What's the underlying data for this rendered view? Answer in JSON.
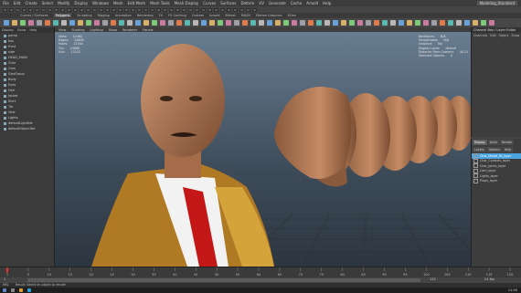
{
  "menubar": {
    "items": [
      "File",
      "Edit",
      "Create",
      "Select",
      "Modify",
      "Display",
      "Windows",
      "Mesh",
      "Edit Mesh",
      "Mesh Tools",
      "Mesh Display",
      "Curves",
      "Surfaces",
      "Deform",
      "UV",
      "Generate",
      "Cache",
      "Arnold",
      "Help"
    ],
    "workspace": "Modeling_Standard"
  },
  "shelf": {
    "tabs": [
      "Curves / Surfaces",
      "Polygons",
      "Sculpting",
      "Rigging",
      "Animation",
      "Rendering",
      "FX",
      "FX Caching",
      "Custom",
      "Arnold",
      "Bifrost",
      "MASH",
      "Motion Graphics",
      "XGen"
    ],
    "active_tab": "Polygons"
  },
  "outliner": {
    "header": [
      "Display",
      "Show",
      "Help"
    ],
    "items": [
      "persp",
      "top",
      "front",
      "side",
      "HEAD_MAIN",
      "Char",
      "Cam",
      "GeoGroup",
      "Body",
      "Eyes",
      "Hair",
      "Jacket",
      "Shirt",
      "Tie",
      "Vest",
      "Lights",
      "defaultLightSet",
      "defaultObjectSet"
    ]
  },
  "viewport": {
    "menu": [
      "View",
      "Shading",
      "Lighting",
      "Show",
      "Renderer",
      "Panels"
    ],
    "hud_left": [
      [
        "Verts:",
        "12480"
      ],
      [
        "Edges:",
        "24806"
      ],
      [
        "Faces:",
        "12344"
      ],
      [
        "Tris:",
        "24688"
      ],
      [
        "UVs:",
        "13102"
      ]
    ],
    "hud_right": [
      [
        "Backfaces:",
        "N/A"
      ],
      [
        "Smoothness:",
        "N/A"
      ],
      [
        "Instance:",
        "No"
      ],
      [
        "Display Layer:",
        "default"
      ],
      [
        "Distance From Camera:",
        "40.21"
      ],
      [
        "Selected Objects:",
        "0"
      ]
    ]
  },
  "channelbox": {
    "title": "Channel Box / Layer Editor",
    "menu": [
      "Channels",
      "Edit",
      "Object",
      "Show"
    ]
  },
  "layers": {
    "tabs": [
      "Display",
      "Anim",
      "Render"
    ],
    "menu": [
      "Layers",
      "Options",
      "Help"
    ],
    "rows": [
      "Char_Model_Hi_layer",
      "Char_Controls_layer",
      "Char_Joints_layer",
      "Cam_layer",
      "Lights_layer",
      "Props_layer"
    ]
  },
  "timeline": {
    "ticks": [
      "1",
      "5",
      "10",
      "15",
      "20",
      "25",
      "30",
      "35",
      "40",
      "45",
      "50",
      "55",
      "60",
      "65",
      "70",
      "75",
      "80",
      "85",
      "90",
      "95",
      "100",
      "105",
      "110",
      "115",
      "120"
    ],
    "current": "1"
  },
  "range": {
    "start": "1",
    "end": "120",
    "fps": "24 fps"
  },
  "cmdline": {
    "label": "MEL",
    "text": "Result: Select an object to render"
  },
  "taskbar": {
    "time": "11:50"
  },
  "colors": {
    "viewport_top": "#6a7f93",
    "viewport_bottom": "#2c3640",
    "skin": "#b27a55",
    "jacket": "#b07a25",
    "tie": "#c41818",
    "highlight": "#4aa3df"
  }
}
